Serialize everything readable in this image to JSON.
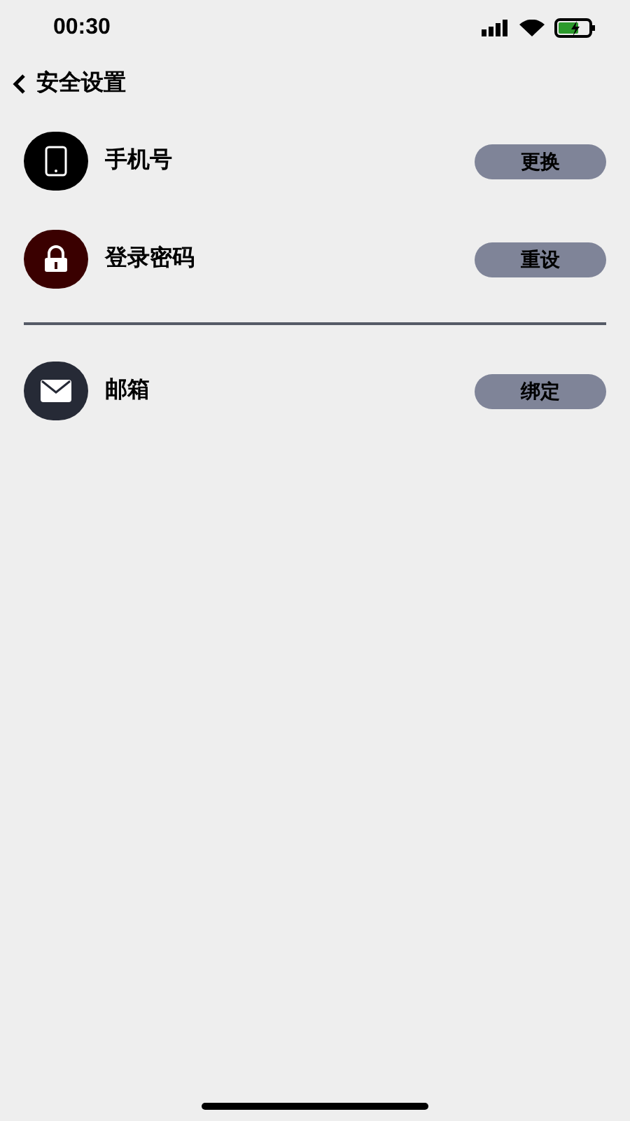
{
  "status_bar": {
    "time": "00:30"
  },
  "header": {
    "title": "安全设置"
  },
  "groups": [
    {
      "items": [
        {
          "kind": "phone",
          "color": "#000000",
          "label": "手机号",
          "action": "更换"
        },
        {
          "kind": "lock",
          "color": "#3a0000",
          "label": "登录密码",
          "action": "重设"
        }
      ]
    },
    {
      "items": [
        {
          "kind": "mail",
          "color": "#262a36",
          "label": "邮箱",
          "action": "绑定"
        }
      ]
    }
  ]
}
